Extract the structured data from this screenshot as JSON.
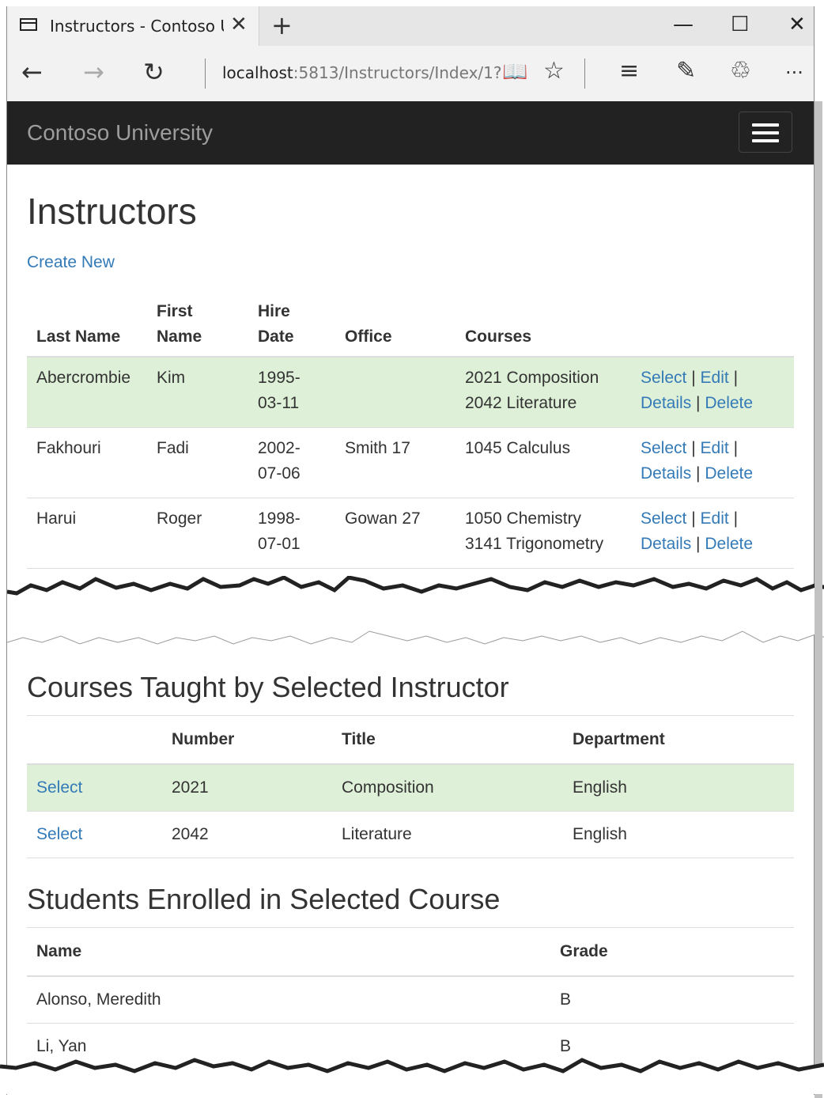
{
  "browser": {
    "tab_title": "Instructors - Contoso University",
    "tab_close": "✕",
    "new_tab": "+",
    "minimize": "—",
    "maximize": "☐",
    "close": "✕",
    "back": "←",
    "forward": "→",
    "refresh": "↻",
    "url_host": "localhost",
    "url_rest": ":5813/Instructors/Index/1?",
    "reading_view": "📖",
    "favorite": "☆",
    "hub": "≡",
    "note": "✎",
    "share": "♲",
    "more": "···"
  },
  "navbar": {
    "brand": "Contoso University"
  },
  "page": {
    "title": "Instructors",
    "create_new": "Create New"
  },
  "instructors": {
    "headers": {
      "last_name": "Last Name",
      "first_name_1": "First",
      "first_name_2": "Name",
      "hire_date_1": "Hire",
      "hire_date_2": "Date",
      "office": "Office",
      "courses": "Courses"
    },
    "action_labels": {
      "select": "Select",
      "edit": "Edit",
      "details": "Details",
      "delete": "Delete",
      "sep": "|"
    },
    "rows": [
      {
        "last": "Abercrombie",
        "first": "Kim",
        "date1": "1995-",
        "date2": "03-11",
        "office": "",
        "course1": "2021 Composition",
        "course2": "2042 Literature",
        "selected": true
      },
      {
        "last": "Fakhouri",
        "first": "Fadi",
        "date1": "2002-",
        "date2": "07-06",
        "office": "Smith 17",
        "course1": "1045 Calculus",
        "course2": "",
        "selected": false
      },
      {
        "last": "Harui",
        "first": "Roger",
        "date1": "1998-",
        "date2": "07-01",
        "office": "Gowan 27",
        "course1": "1050 Chemistry",
        "course2": "3141 Trigonometry",
        "selected": false
      }
    ]
  },
  "courses_section": {
    "title": "Courses Taught by Selected Instructor",
    "headers": {
      "blank": "",
      "number": "Number",
      "title": "Title",
      "department": "Department"
    },
    "rows": [
      {
        "select": "Select",
        "number": "2021",
        "title": "Composition",
        "department": "English",
        "selected": true
      },
      {
        "select": "Select",
        "number": "2042",
        "title": "Literature",
        "department": "English",
        "selected": false
      }
    ]
  },
  "students_section": {
    "title": "Students Enrolled in Selected Course",
    "headers": {
      "name": "Name",
      "grade": "Grade"
    },
    "rows": [
      {
        "name": "Alonso, Meredith",
        "grade": "B"
      },
      {
        "name": "Li, Yan",
        "grade": "B"
      }
    ]
  },
  "colors": {
    "navbar_bg": "#222222",
    "link": "#337ab7",
    "selected_row": "#dff0d8"
  }
}
